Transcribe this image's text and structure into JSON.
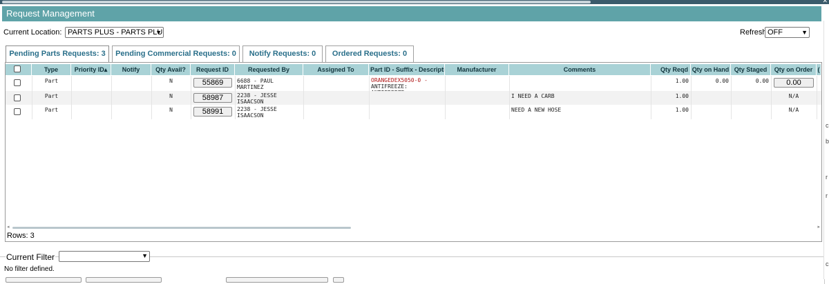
{
  "panel": {
    "title": "Request Management"
  },
  "location": {
    "label": "Current Location:",
    "value": "PARTS PLUS - PARTS PLUS"
  },
  "refresh": {
    "label": "Refresh",
    "value": "OFF"
  },
  "tabs": [
    {
      "label": "Pending Parts Requests: 3",
      "active": true
    },
    {
      "label": "Pending Commercial Requests: 0",
      "active": false
    },
    {
      "label": "Notify Requests: 0",
      "active": false
    },
    {
      "label": "Ordered Requests: 0",
      "active": false
    }
  ],
  "columns": [
    "",
    "Type",
    "Priority ID▴",
    "Notify",
    "Qty Avail?",
    "Request ID",
    "Requested By",
    "Assigned To",
    "Part ID - Suffix - Description",
    "Manufacturer",
    "Comments",
    "Qty Reqd",
    "Qty on Hand",
    "Qty Staged",
    "Qty on Order",
    "("
  ],
  "rows": [
    {
      "type": "Part",
      "priority": "",
      "notify": "",
      "qty_avail": "N",
      "request_id": "55869",
      "requested_by": "6688 - PAUL MARTINEZ",
      "assigned_to": "",
      "part_id": "ORANGEDEX5050-0 -",
      "part_desc": "ANTIFREEZE: ANTIFREEZE",
      "manufacturer": "",
      "comments": "",
      "qty_reqd": "1.00",
      "qty_on_hand": "0.00",
      "qty_staged": "0.00",
      "qty_on_order": "0.00"
    },
    {
      "type": "Part",
      "priority": "",
      "notify": "",
      "qty_avail": "N",
      "request_id": "58987",
      "requested_by": "2238 - JESSE ISAACSON",
      "assigned_to": "",
      "part_id": "",
      "part_desc": "",
      "manufacturer": "",
      "comments": "I NEED A CARB",
      "qty_reqd": "1.00",
      "qty_on_hand": "",
      "qty_staged": "",
      "qty_on_order": "N/A"
    },
    {
      "type": "Part",
      "priority": "",
      "notify": "",
      "qty_avail": "N",
      "request_id": "58991",
      "requested_by": "2238 - JESSE ISAACSON",
      "assigned_to": "",
      "part_id": "",
      "part_desc": "",
      "manufacturer": "",
      "comments": "NEED A NEW HOSE",
      "qty_reqd": "1.00",
      "qty_on_hand": "",
      "qty_staged": "",
      "qty_on_order": "N/A"
    }
  ],
  "footer": {
    "rows_label": "Rows: 3"
  },
  "filter": {
    "legend": "Current Filter",
    "value": "",
    "status": "No filter defined."
  },
  "right_strip_chars": [
    "c",
    "b",
    "r",
    "r",
    "c"
  ],
  "colors": {
    "header_bar": "#5fa3a8",
    "grid_header": "#a9d2d6",
    "tab_text": "#2a6f8a",
    "part_link": "#b01818"
  },
  "icons": {
    "select_caret": "chevron-down-icon",
    "checkbox": "checkbox-icon",
    "scroll_left": "scroll-left-icon",
    "scroll_right": "scroll-right-icon"
  }
}
